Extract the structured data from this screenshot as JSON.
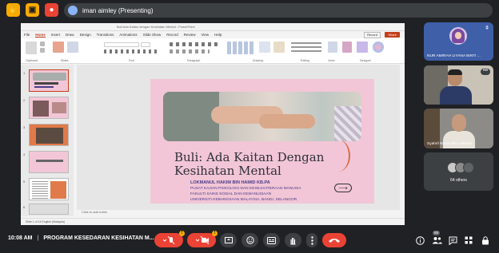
{
  "meeting": {
    "presenting_label": "iman aimley (Presenting)",
    "time": "10:08 AM",
    "title": "PROGRAM KESEDARAN KESIHATAN M...",
    "people_count": "68"
  },
  "ppt": {
    "window_title": "Buli Ada Kaitan dengan Kesihatan Mental - PowerPoint",
    "menu": [
      "File",
      "Home",
      "Insert",
      "Draw",
      "Design",
      "Transitions",
      "Animations",
      "Slide Show",
      "Record",
      "Review",
      "View",
      "Help"
    ],
    "record_label": "Record",
    "share_label": "Share",
    "groups": [
      "Clipboard",
      "Slides",
      "Font",
      "Paragraph",
      "Drawing",
      "Editing",
      "Voice",
      "Designer"
    ],
    "notes_placeholder": "Click to add notes",
    "status_text": "Slide 1 of 14   English (Malaysia)",
    "thumb_numbers": [
      "1",
      "2",
      "3",
      "4",
      "5",
      "6"
    ]
  },
  "slide": {
    "title_line1": "Buli: Ada Kaitan Dengan",
    "title_line2": "Kesihatan Mental",
    "author": "LOKMANUL HAKIM BIN HAMID KB.PA",
    "aff1": "PUSAT KAJIAN PSIKOLOGI DAN KESEJAHTERAAN MANUSIA",
    "aff2": "FAKULTI SAINS SOSIAL DAN KEMANUSIAAN",
    "aff3": "UNIVERSITI KEBANGSAAN MALAYSIA, BANGI, SELANGOR"
  },
  "participants": [
    {
      "name": "NUR AMIRAH LIYANA BINTI ..."
    },
    {
      "name": ""
    },
    {
      "name": "Syahril Nizam Bin Lukman"
    },
    {
      "name": "64 others"
    }
  ],
  "icons": [
    "hand-icon",
    "pin-icon",
    "record-icon",
    "mic-off-icon",
    "camera-off-icon",
    "present-icon",
    "emoji-icon",
    "captions-icon",
    "raise-hand-icon",
    "more-icon",
    "end-call-icon",
    "info-icon",
    "people-icon",
    "chat-icon",
    "activities-icon",
    "lock-icon"
  ],
  "colors": {
    "background": "#202124",
    "accent_red": "#ea4335",
    "pill": "#3c4043",
    "badge_yellow": "#f9ab00",
    "ppt_accent": "#c43e1c",
    "slide_bg": "#f2c6d6"
  }
}
